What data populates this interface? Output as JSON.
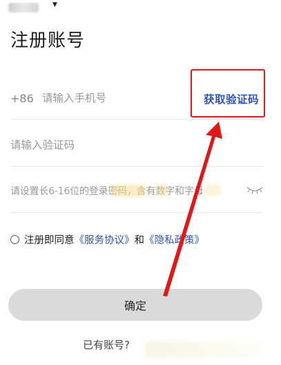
{
  "title": "注册账号",
  "phone": {
    "country_code": "+86",
    "placeholder": "请输入手机号",
    "get_code_label": "获取验证码"
  },
  "code": {
    "placeholder": "请输入验证码"
  },
  "password": {
    "placeholder": "请设置长6-16位的登录密码，含有数字和字母"
  },
  "agreement": {
    "prefix": "注册即同意",
    "service_link": "《服务协议》",
    "and": "和",
    "privacy_link": "《隐私政策》"
  },
  "confirm_label": "确定",
  "have_account": "已有账号?",
  "colors": {
    "accent": "#2f55b8",
    "annotation": "#e01818",
    "button_bg": "#dadada"
  },
  "icons": [
    "chevron-down-icon",
    "eye-closed-icon",
    "radio-icon",
    "arrow-annotation"
  ]
}
